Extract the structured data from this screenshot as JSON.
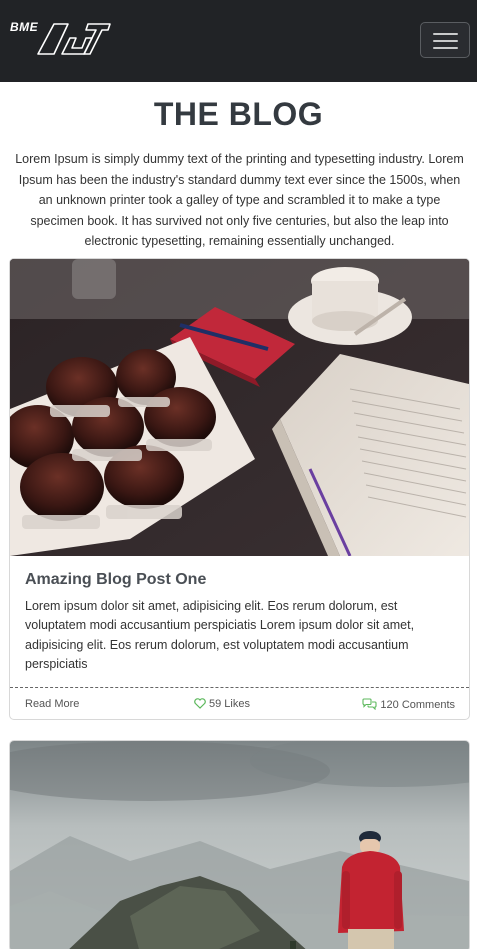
{
  "navbar": {
    "logo_small": "BME",
    "logo_large": "AUT",
    "toggler_icon": "hamburger-icon"
  },
  "page": {
    "title": "THE BLOG",
    "intro": "Lorem Ipsum is simply dummy text of the printing and typesetting industry. Lorem Ipsum has been the industry's standard dummy text ever since the 1500s, when an unknown printer took a galley of type and scrambled it to make a type specimen book. It has survived not only five centuries, but also the leap into electronic typesetting, remaining essentially unchanged."
  },
  "posts": [
    {
      "image": "muffins-coffee-book-photo",
      "title": "Amazing Blog Post One",
      "body": "Lorem ipsum dolor sit amet, adipisicing elit. Eos rerum dolorum, est voluptatem modi accusantium perspiciatis Lorem ipsum dolor sit amet, adipisicing elit. Eos rerum dolorum, est voluptatem modi accusantium perspiciatis",
      "read_more": "Read More",
      "likes": "59 Likes",
      "comments": "120 Comments",
      "like_color": "#5cb85c",
      "comment_color": "#5cb85c"
    },
    {
      "image": "hiker-mountain-photo"
    }
  ]
}
